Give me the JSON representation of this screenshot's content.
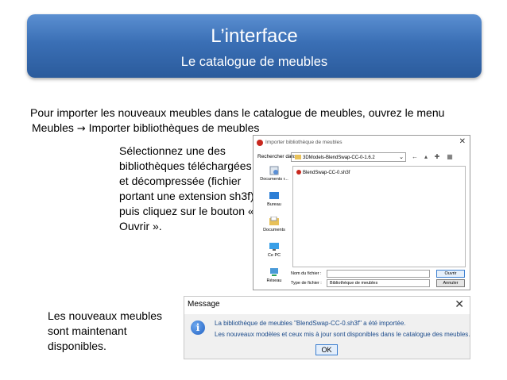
{
  "slide": {
    "title": "L’interface",
    "subtitle": "Le catalogue de meubles",
    "intro_line1": "Pour importer les nouveaux meubles dans le catalogue de meubles, ouvrez le menu",
    "intro_line2_menu": "Meubles",
    "intro_line2_arrow": "→",
    "intro_line2_item": "Importer bibliothèques de meubles",
    "select_instructions": "Sélectionnez une des bibliothèques téléchargées et décompressée (fichier portant une extension sh3f) puis cliquez sur le bouton « Ouvrir ».",
    "available_text": "Les nouveaux meubles sont maintenant disponibles."
  },
  "file_dialog": {
    "title": "Importer bibliothèque de meubles",
    "close": "✕",
    "look_in_label": "Rechercher dans :",
    "look_in_value": "3DModels-BlendSwap-CC-0-1.6.2",
    "places": [
      "Documents r...",
      "Bureau",
      "Documents",
      "Ce PC",
      "Réseau"
    ],
    "file_name": "BlendSwap-CC-0.sh3f",
    "file_name_label": "Nom du fichier :",
    "file_type_label": "Type de fichier :",
    "file_type_value": "Bibliothèque de meubles",
    "open_button": "Ouvrir",
    "cancel_button": "Annuler"
  },
  "message_box": {
    "title": "Message",
    "close": "✕",
    "line1": "La bibliothèque de meubles \"BlendSwap-CC-0.sh3f\" a été importée.",
    "line2": "Les nouveaux modèles et ceux mis à jour sont disponibles dans le catalogue des meubles.",
    "ok_button": "OK"
  },
  "colors": {
    "banner_top": "#5b8fd1",
    "banner_bottom": "#2b5b9c",
    "message_text": "#1a4a8a"
  }
}
